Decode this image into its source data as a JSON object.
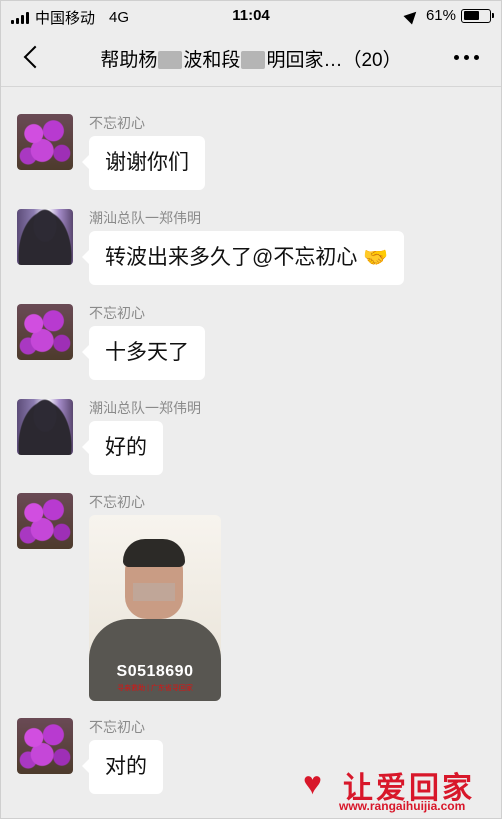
{
  "status_bar": {
    "carrier": "中国移动",
    "network": "4G",
    "time": "11:04",
    "battery": "61%",
    "battery_level": 0.61
  },
  "nav": {
    "title_part1": "帮助杨",
    "title_part2": "波和段",
    "title_part3": "明回家…（20）"
  },
  "messages": [
    {
      "sender": "不忘初心",
      "text": "谢谢你们",
      "avatar": "orchid-avatar"
    },
    {
      "sender": "潮汕总队一郑伟明",
      "text": "转波出来多久了@不忘初心",
      "avatar": "person-avatar",
      "icon": "🤝"
    },
    {
      "sender": "不忘初心",
      "text": "十多天了",
      "avatar": "orchid-avatar"
    },
    {
      "sender": "潮汕总队一郑伟明",
      "text": "好的",
      "avatar": "person-avatar"
    },
    {
      "sender": "不忘初心",
      "avatar": "orchid-avatar",
      "photo_id": "S0518690",
      "photo_caption": "寻亲救助 | 广东省寻回家"
    },
    {
      "sender": "不忘初心",
      "text": "对的",
      "avatar": "orchid-avatar"
    }
  ],
  "watermark": {
    "logo_text": "让爱回家",
    "url": "www.rangaihuijia.com"
  }
}
